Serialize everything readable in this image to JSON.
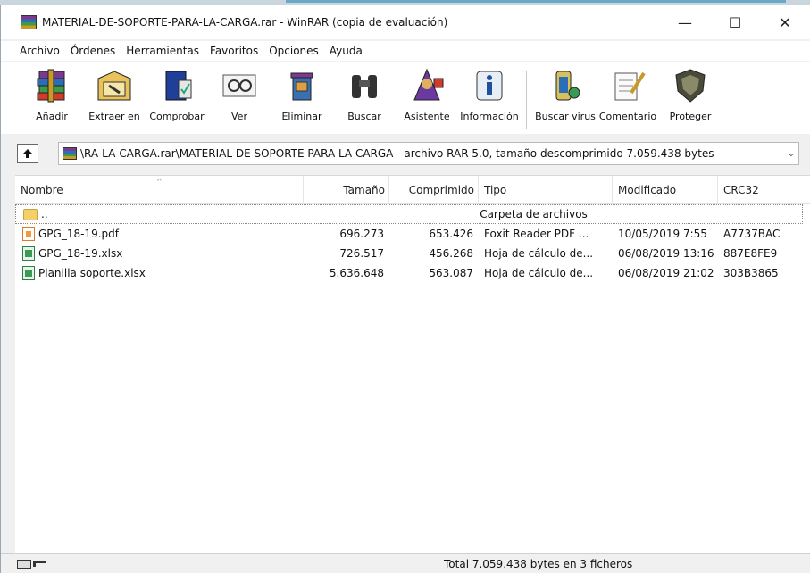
{
  "window": {
    "title": "MATERIAL-DE-SOPORTE-PARA-LA-CARGA.rar - WinRAR (copia de evaluación)",
    "controls": {
      "minimize": "—",
      "maximize": "☐",
      "close": "✕"
    }
  },
  "menu": [
    "Archivo",
    "Órdenes",
    "Herramientas",
    "Favoritos",
    "Opciones",
    "Ayuda"
  ],
  "toolbar": [
    {
      "label": "Añadir",
      "icon": "add-books-icon"
    },
    {
      "label": "Extraer en",
      "icon": "extract-icon"
    },
    {
      "label": "Comprobar",
      "icon": "test-icon"
    },
    {
      "label": "Ver",
      "icon": "view-icon"
    },
    {
      "label": "Eliminar",
      "icon": "delete-icon"
    },
    {
      "label": "Buscar",
      "icon": "binoculars-icon"
    },
    {
      "label": "Asistente",
      "icon": "wizard-icon"
    },
    {
      "label": "Información",
      "icon": "info-icon"
    },
    {
      "label": "Buscar virus",
      "icon": "virus-scan-icon"
    },
    {
      "label": "Comentario",
      "icon": "comment-icon"
    },
    {
      "label": "Proteger",
      "icon": "shield-icon"
    }
  ],
  "address": {
    "text": "\\RA-LA-CARGA.rar\\MATERIAL DE SOPORTE PARA LA CARGA - archivo RAR 5.0, tamaño descomprimido 7.059.438 bytes"
  },
  "columns": {
    "name": "Nombre",
    "size": "Tamaño",
    "compressed": "Comprimido",
    "type": "Tipo",
    "modified": "Modificado",
    "crc": "CRC32"
  },
  "files": [
    {
      "icon": "folder",
      "name": "..",
      "size": "",
      "compressed": "",
      "type": "Carpeta de archivos",
      "modified": "",
      "crc": ""
    },
    {
      "icon": "pdf",
      "name": "GPG_18-19.pdf",
      "size": "696.273",
      "compressed": "653.426",
      "type": "Foxit Reader PDF ...",
      "modified": "10/05/2019 7:55",
      "crc": "A7737BAC"
    },
    {
      "icon": "xlsx",
      "name": "GPG_18-19.xlsx",
      "size": "726.517",
      "compressed": "456.268",
      "type": "Hoja de cálculo de...",
      "modified": "06/08/2019 13:16",
      "crc": "887E8FE9"
    },
    {
      "icon": "xlsx",
      "name": "Planilla soporte.xlsx",
      "size": "5.636.648",
      "compressed": "563.087",
      "type": "Hoja de cálculo de...",
      "modified": "06/08/2019 21:02",
      "crc": "303B3865"
    }
  ],
  "status": {
    "text": "Total 7.059.438 bytes en 3 ficheros"
  }
}
